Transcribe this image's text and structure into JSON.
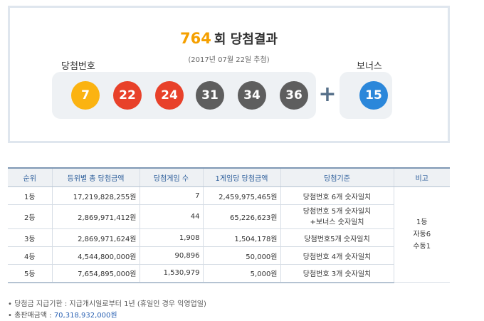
{
  "header": {
    "round": "764",
    "title_suffix": "회 당첨결과",
    "draw_date": "(2017년 07월 22일 추첨)",
    "winning_label": "당첨번호",
    "bonus_label": "보너스",
    "plus_symbol": "+"
  },
  "numbers": [
    {
      "value": "7",
      "color": "#fbb311"
    },
    {
      "value": "22",
      "color": "#e8412a"
    },
    {
      "value": "24",
      "color": "#e8412a"
    },
    {
      "value": "31",
      "color": "#5e5e5e"
    },
    {
      "value": "34",
      "color": "#5e5e5e"
    },
    {
      "value": "36",
      "color": "#5e5e5e"
    }
  ],
  "bonus": {
    "value": "15",
    "color": "#2b87da"
  },
  "table": {
    "headers": [
      "순위",
      "등위별 총 당첨금액",
      "당첨게임 수",
      "1게임당 당첨금액",
      "당첨기준",
      "비고"
    ],
    "rows": [
      {
        "rank": "1등",
        "total": "17,219,828,255원",
        "games": "7",
        "per_game": "2,459,975,465원",
        "criteria_a": "당첨번호 6개 숫자일치",
        "criteria_b": ""
      },
      {
        "rank": "2등",
        "total": "2,869,971,412원",
        "games": "44",
        "per_game": "65,226,623원",
        "criteria_a": "당첨번호 5개 숫자일치",
        "criteria_b": "+보너스 숫자일치"
      },
      {
        "rank": "3등",
        "total": "2,869,971,624원",
        "games": "1,908",
        "per_game": "1,504,178원",
        "criteria_a": "당첨번호5개 숫자일치",
        "criteria_b": ""
      },
      {
        "rank": "4등",
        "total": "4,544,800,000원",
        "games": "90,896",
        "per_game": "50,000원",
        "criteria_a": "당첨번호 4개 숫자일치",
        "criteria_b": ""
      },
      {
        "rank": "5등",
        "total": "7,654,895,000원",
        "games": "1,530,979",
        "per_game": "5,000원",
        "criteria_a": "당첨번호 3개 숫자일치",
        "criteria_b": ""
      }
    ],
    "note_lines": [
      "1등",
      "자동6",
      "수동1"
    ]
  },
  "footer": {
    "deadline_label": "• 당첨금 지급기한 : 지급개시일로부터 1년 (휴일인 경우 익영업일)",
    "sales_label": "• 총판매금액 : ",
    "sales_value": "70,318,932,000원"
  },
  "colors": {
    "round_accent": "#f5a000",
    "header_text": "#2b5d9a",
    "sales_value": "#2b62b3"
  }
}
